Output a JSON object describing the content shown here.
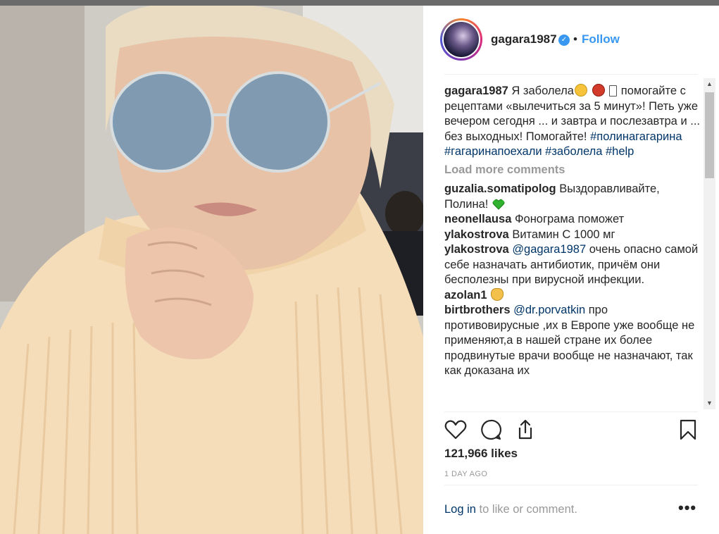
{
  "colors": {
    "link": "#003569",
    "accent": "#3897f0",
    "muted": "#999999",
    "text": "#262626"
  },
  "header": {
    "username": "gagara1987",
    "verified_icon": "verified-badge-icon",
    "separator": "•",
    "follow_label": "Follow"
  },
  "caption": {
    "user": "gagara1987",
    "text_1": "Я заболела",
    "emojis": [
      "grimacing-emoji",
      "angry-emoji",
      "unknown-glyph"
    ],
    "text_2": "помогайте с рецептами «вылечиться за 5 минут»! Петь уже вечером сегодня ... и завтра и послезавтра и ... без выходных! Помогайте!",
    "tags": [
      "#полинагагарина",
      "#гагаринапоехали",
      "#заболела",
      "#help"
    ]
  },
  "load_more": "Load more comments",
  "comments": [
    {
      "user": "guzalia.somatipolog",
      "text": "Выздоравливайте, Полина!",
      "emoji": "green-heart-emoji"
    },
    {
      "user": "neonellausa",
      "text": "Фонограма поможет"
    },
    {
      "user": "ylakostrova",
      "text": "Витамин С 1000 мг"
    },
    {
      "user": "ylakostrova",
      "mention": "@gagara1987",
      "text": "очень опасно самой себе назначать антибиотик, причём они бесполезны при вирусной инфекции."
    },
    {
      "user": "azolan1",
      "text": "",
      "emoji": "clapping-hands-emoji"
    },
    {
      "user": "birtbrothers",
      "mention": "@dr.porvatkin",
      "text": "про противовирусные ,их в Европе уже вообще не применяют,а в нашей стране их более продвинутые врачи вообще не назначают, так как доказана их"
    }
  ],
  "actions": {
    "like_icon": "heart-icon",
    "comment_icon": "comment-bubble-icon",
    "share_icon": "share-icon",
    "save_icon": "bookmark-icon"
  },
  "likes": "121,966 likes",
  "timestamp": "1 DAY AGO",
  "footer": {
    "login_link": "Log in",
    "login_text": " to like or comment.",
    "more_icon": "more-options-icon",
    "more_label": "•••"
  }
}
